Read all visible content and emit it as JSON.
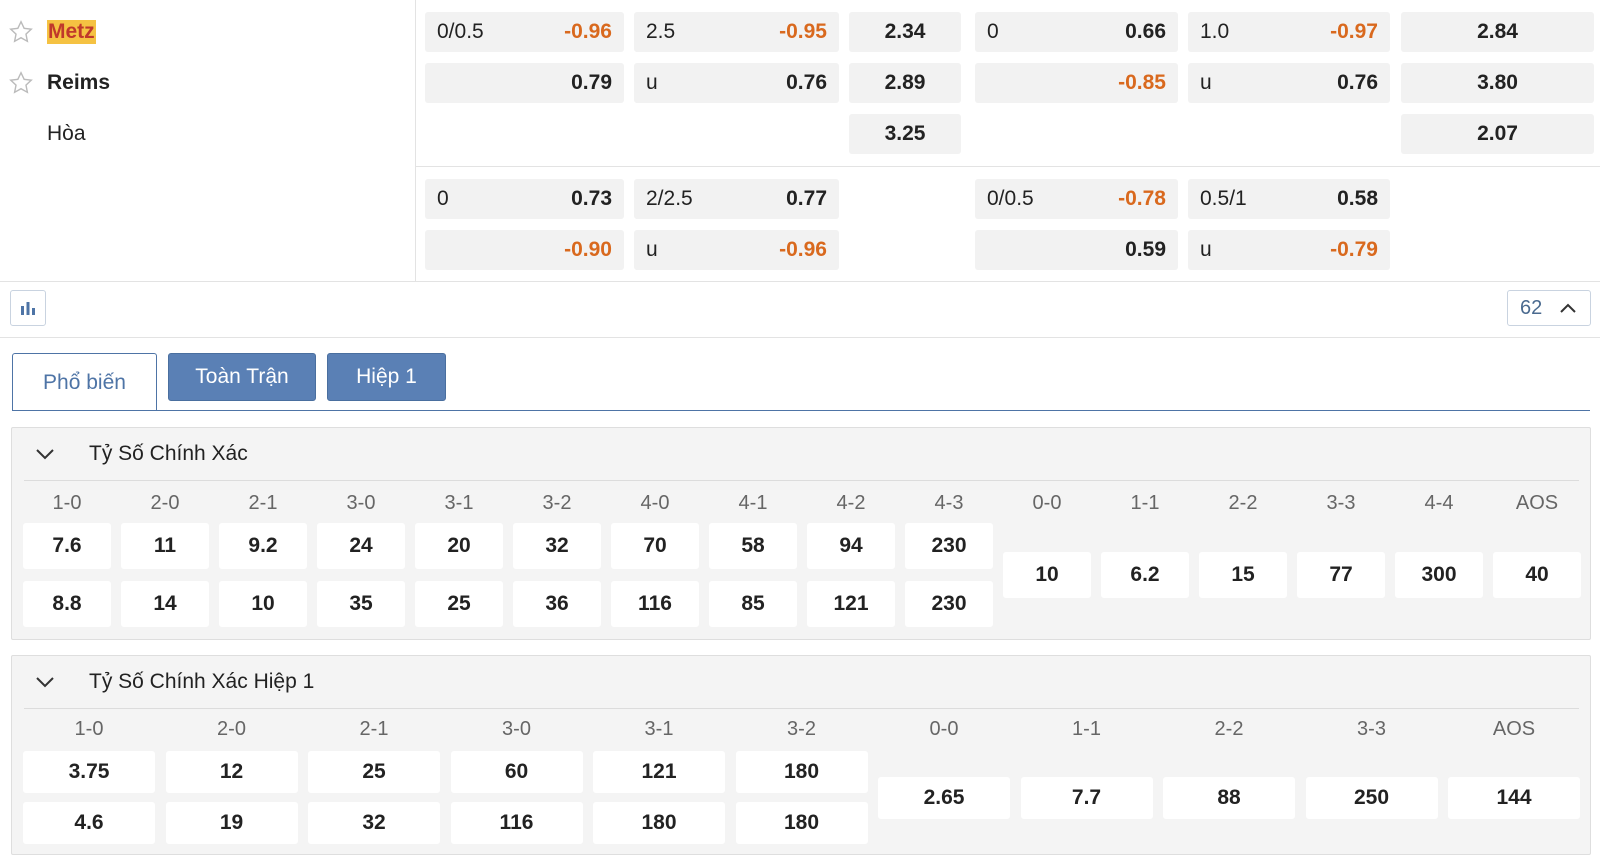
{
  "teams": {
    "home": "Metz",
    "away": "Reims",
    "draw": "Hòa"
  },
  "odds_main": {
    "row1": {
      "hdp_ft_line": "0/0.5",
      "hdp_ft_val": "-0.96",
      "ou_ft_line": "2.5",
      "ou_ft_val": "-0.95",
      "x12_ft": "2.34",
      "hdp_h1_line": "0",
      "hdp_h1_val": "0.66",
      "ou_h1_line": "1.0",
      "ou_h1_val": "-0.97",
      "x12_h1": "2.84"
    },
    "row2": {
      "hdp_ft_val": "0.79",
      "ou_ft_line": "u",
      "ou_ft_val": "0.76",
      "x12_ft": "2.89",
      "hdp_h1_val": "-0.85",
      "ou_h1_line": "u",
      "ou_h1_val": "0.76",
      "x12_h1": "3.80"
    },
    "row3": {
      "x12_ft": "3.25",
      "x12_h1": "2.07"
    }
  },
  "odds_alt": {
    "row1": {
      "hdp_ft_line": "0",
      "hdp_ft_val": "0.73",
      "ou_ft_line": "2/2.5",
      "ou_ft_val": "0.77",
      "hdp_h1_line": "0/0.5",
      "hdp_h1_val": "-0.78",
      "ou_h1_line": "0.5/1",
      "ou_h1_val": "0.58"
    },
    "row2": {
      "hdp_ft_val": "-0.90",
      "ou_ft_line": "u",
      "ou_ft_val": "-0.96",
      "hdp_h1_val": "0.59",
      "ou_h1_line": "u",
      "ou_h1_val": "-0.79"
    }
  },
  "toolbar": {
    "market_count": "62",
    "chart_icon": "bar-chart-icon",
    "collapse_icon": "chevron-up-icon"
  },
  "tabs": [
    "Phổ biến",
    "Toàn Trận",
    "Hiệp 1"
  ],
  "correct_score_ft": {
    "title": "Tỷ Số Chính Xác",
    "win_headers": [
      "1-0",
      "2-0",
      "2-1",
      "3-0",
      "3-1",
      "3-2",
      "4-0",
      "4-1",
      "4-2",
      "4-3"
    ],
    "home_odds": [
      "7.6",
      "11",
      "9.2",
      "24",
      "20",
      "32",
      "70",
      "58",
      "94",
      "230"
    ],
    "away_odds": [
      "8.8",
      "14",
      "10",
      "35",
      "25",
      "36",
      "116",
      "85",
      "121",
      "230"
    ],
    "draw_headers": [
      "0-0",
      "1-1",
      "2-2",
      "3-3",
      "4-4",
      "AOS"
    ],
    "draw_odds": [
      "10",
      "6.2",
      "15",
      "77",
      "300",
      "40"
    ]
  },
  "correct_score_h1": {
    "title": "Tỷ Số Chính Xác Hiệp 1",
    "win_headers": [
      "1-0",
      "2-0",
      "2-1",
      "3-0",
      "3-1",
      "3-2"
    ],
    "home_odds": [
      "3.75",
      "12",
      "25",
      "60",
      "121",
      "180"
    ],
    "away_odds": [
      "4.6",
      "19",
      "32",
      "116",
      "180",
      "180"
    ],
    "draw_headers": [
      "0-0",
      "1-1",
      "2-2",
      "3-3",
      "AOS"
    ],
    "draw_odds": [
      "2.65",
      "7.7",
      "88",
      "250",
      "144"
    ]
  },
  "colors": {
    "negative": "#d9691e",
    "accent": "#4e74a6",
    "tab_blue": "#5a80b5",
    "highlight": "#f5c242"
  }
}
